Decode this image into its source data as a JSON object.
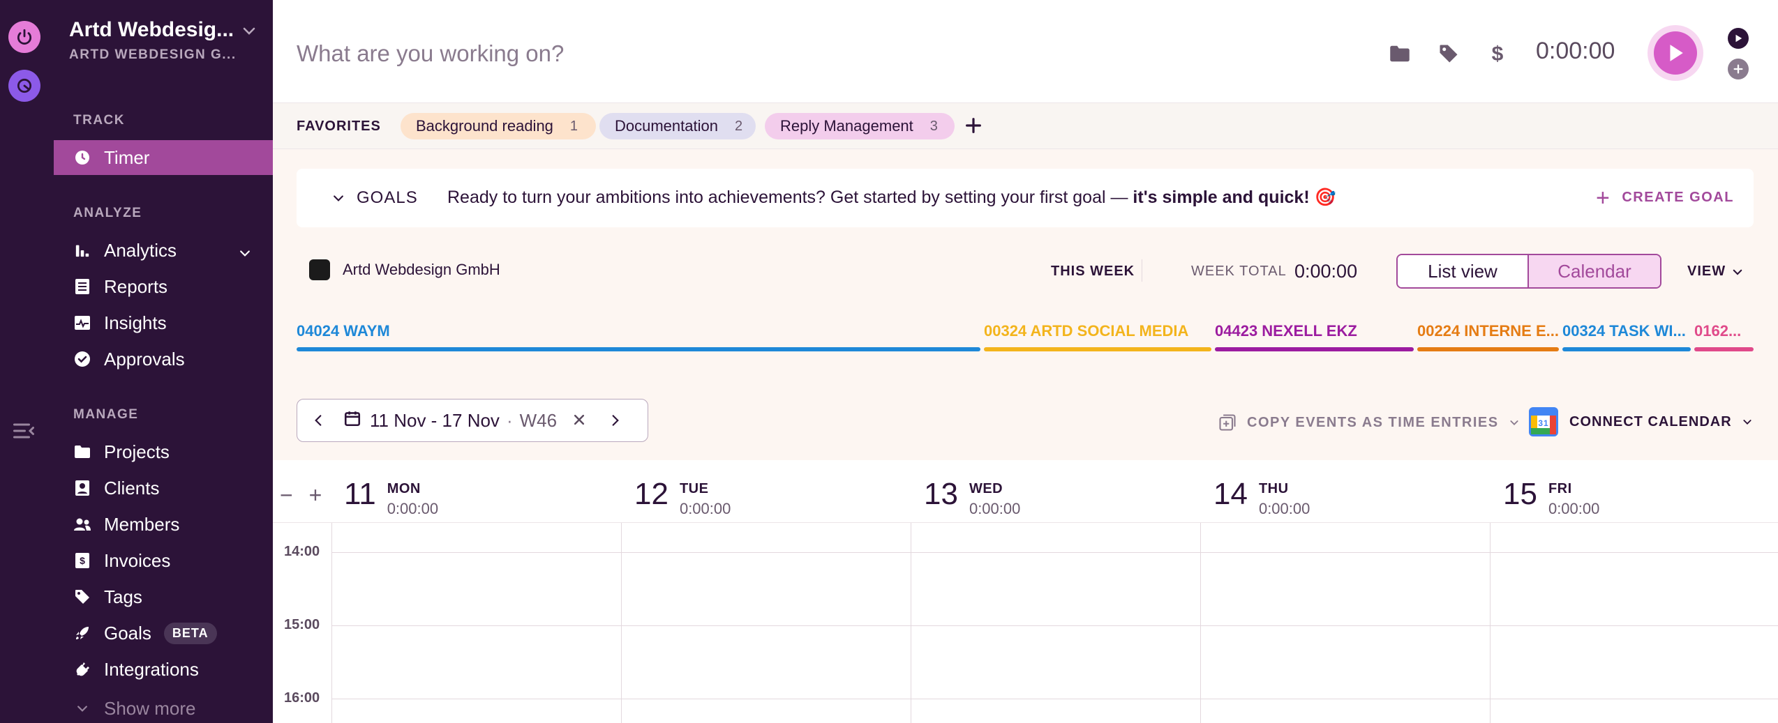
{
  "workspace": {
    "name": "Artd Webdesig...",
    "subtitle": "ARTD WEBDESIGN G..."
  },
  "sidebar": {
    "track_label": "TRACK",
    "analyze_label": "ANALYZE",
    "manage_label": "MANAGE",
    "items": [
      {
        "label": "Timer",
        "icon": "clock-icon"
      },
      {
        "label": "Analytics",
        "icon": "bar-chart-icon"
      },
      {
        "label": "Reports",
        "icon": "report-icon"
      },
      {
        "label": "Insights",
        "icon": "insights-icon"
      },
      {
        "label": "Approvals",
        "icon": "check-circle-icon"
      },
      {
        "label": "Projects",
        "icon": "folder-icon"
      },
      {
        "label": "Clients",
        "icon": "client-icon"
      },
      {
        "label": "Members",
        "icon": "members-icon"
      },
      {
        "label": "Invoices",
        "icon": "invoice-icon"
      },
      {
        "label": "Tags",
        "icon": "tag-icon"
      },
      {
        "label": "Goals",
        "icon": "rocket-icon",
        "badge": "BETA"
      },
      {
        "label": "Integrations",
        "icon": "plug-icon"
      },
      {
        "label": "Show more",
        "icon": "chevron-down-icon"
      }
    ]
  },
  "topbar": {
    "placeholder": "What are you working on?",
    "timer": "0:00:00"
  },
  "favorites": {
    "label": "FAVORITES",
    "items": [
      {
        "label": "Background reading",
        "count": "1",
        "color": "#fde3cc"
      },
      {
        "label": "Documentation",
        "count": "2",
        "color": "#e0def0"
      },
      {
        "label": "Reply Management",
        "count": "3",
        "color": "#f3cdec"
      }
    ]
  },
  "goals": {
    "label": "GOALS",
    "text": "Ready to turn your ambitions into achievements? Get started by setting your first goal — ",
    "text_bold": "it's simple and quick!",
    "emoji": "🎯",
    "create_label": "CREATE GOAL"
  },
  "summary": {
    "workspace": "Artd Webdesign GmbH",
    "period": "THIS WEEK",
    "total_label": "WEEK TOTAL",
    "total_value": "0:00:00",
    "list_view": "List view",
    "calendar_view": "Calendar",
    "view_label": "VIEW"
  },
  "projects": [
    {
      "label": "04024 WAYM",
      "color": "#1e88d8"
    },
    {
      "label": "00324 ARTD SOCIAL MEDIA",
      "color": "#f3b41c"
    },
    {
      "label": "04423 NEXELL EKZ",
      "color": "#9c1ca0"
    },
    {
      "label": "00224 INTERNE E...",
      "color": "#e57c14"
    },
    {
      "label": "00324 TASK WI...",
      "color": "#1e88d8"
    },
    {
      "label": "0162...",
      "color": "#e04a8a"
    }
  ],
  "date_range": {
    "label": "11 Nov - 17 Nov",
    "week": "W46"
  },
  "copy_events_label": "COPY EVENTS AS TIME ENTRIES",
  "connect_calendar_label": "CONNECT CALENDAR",
  "calendar": {
    "zoom_out": "−",
    "zoom_in": "+",
    "days": [
      {
        "num": "11",
        "name": "MON",
        "time": "0:00:00"
      },
      {
        "num": "12",
        "name": "TUE",
        "time": "0:00:00"
      },
      {
        "num": "13",
        "name": "WED",
        "time": "0:00:00"
      },
      {
        "num": "14",
        "name": "THU",
        "time": "0:00:00"
      },
      {
        "num": "15",
        "name": "FRI",
        "time": "0:00:00"
      }
    ],
    "hours": [
      "14:00",
      "15:00",
      "16:00"
    ]
  }
}
